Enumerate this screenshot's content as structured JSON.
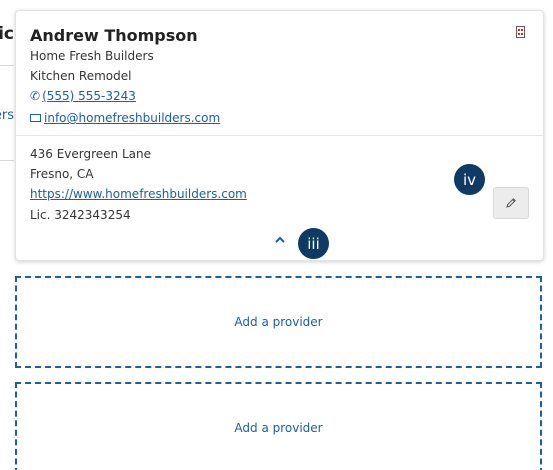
{
  "background": {
    "title_fragment": "Provic",
    "link_fragment": "Providers"
  },
  "provider": {
    "name": "Andrew Thompson",
    "company": "Home Fresh Builders",
    "service": "Kitchen Remodel",
    "phone": "(555) 555-3243",
    "email": "info@homefreshbuilders.com",
    "address_line1": "436 Evergreen Lane",
    "address_line2": "Fresno, CA",
    "website": "https://www.homefreshbuilders.com",
    "license": "Lic. 3242343254"
  },
  "markers": {
    "collapse": "iii",
    "edit": "iv"
  },
  "placeholders": [
    {
      "label": "Add a provider"
    },
    {
      "label": "Add a provider"
    }
  ],
  "colors": {
    "link": "#1a5fa8",
    "marker": "#0e3a63",
    "building_icon": "#8a4b4b"
  },
  "icons": {
    "phone": "phone-icon",
    "email": "mail-icon",
    "company_type": "building-icon",
    "edit": "pencil-icon",
    "collapse": "chevron-up-icon"
  }
}
